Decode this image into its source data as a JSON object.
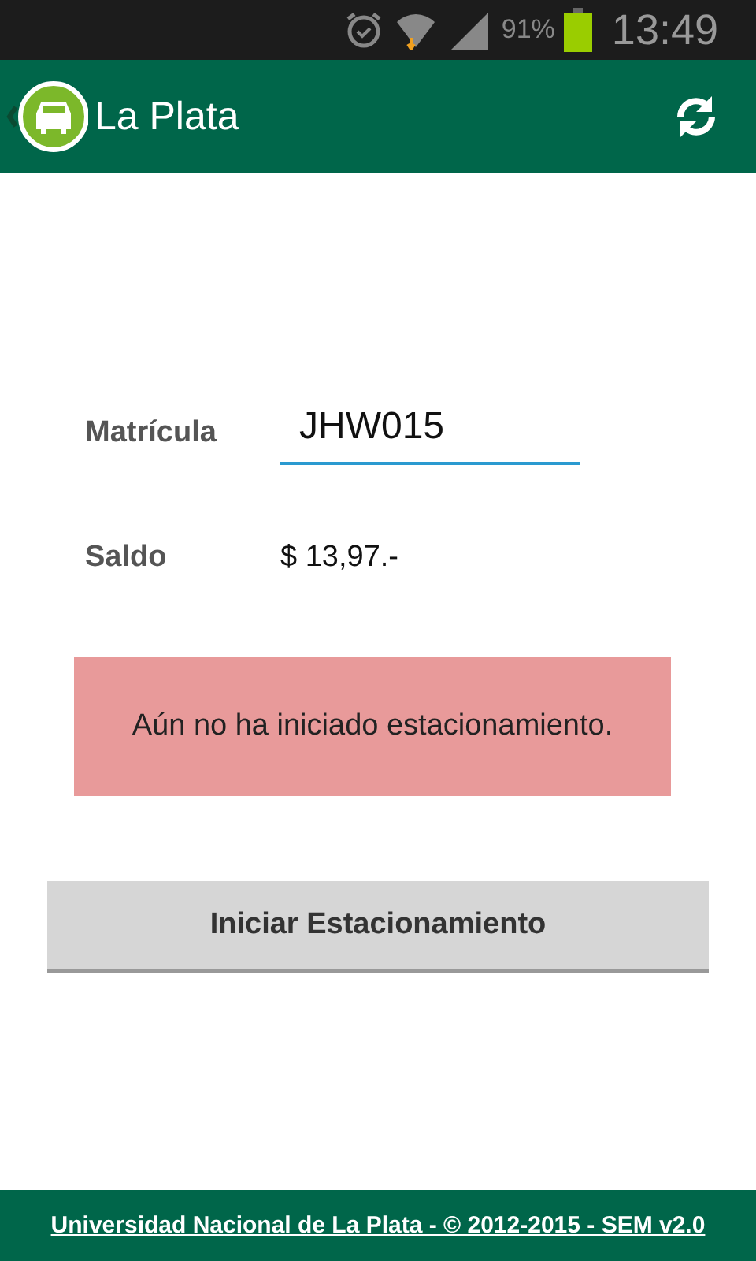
{
  "status_bar": {
    "battery": "91%",
    "time": "13:49"
  },
  "app_bar": {
    "title": "La Plata"
  },
  "form": {
    "plate_label": "Matrícula",
    "plate_value": "JHW015",
    "balance_label": "Saldo",
    "balance_value": "$ 13,97.-"
  },
  "alert": {
    "message": "Aún no ha iniciado estacionamiento."
  },
  "action_button": {
    "label": "Iniciar Estacionamiento"
  },
  "footer": {
    "link": "Universidad Nacional de La Plata - © 2012-2015 - SEM v2.0"
  }
}
